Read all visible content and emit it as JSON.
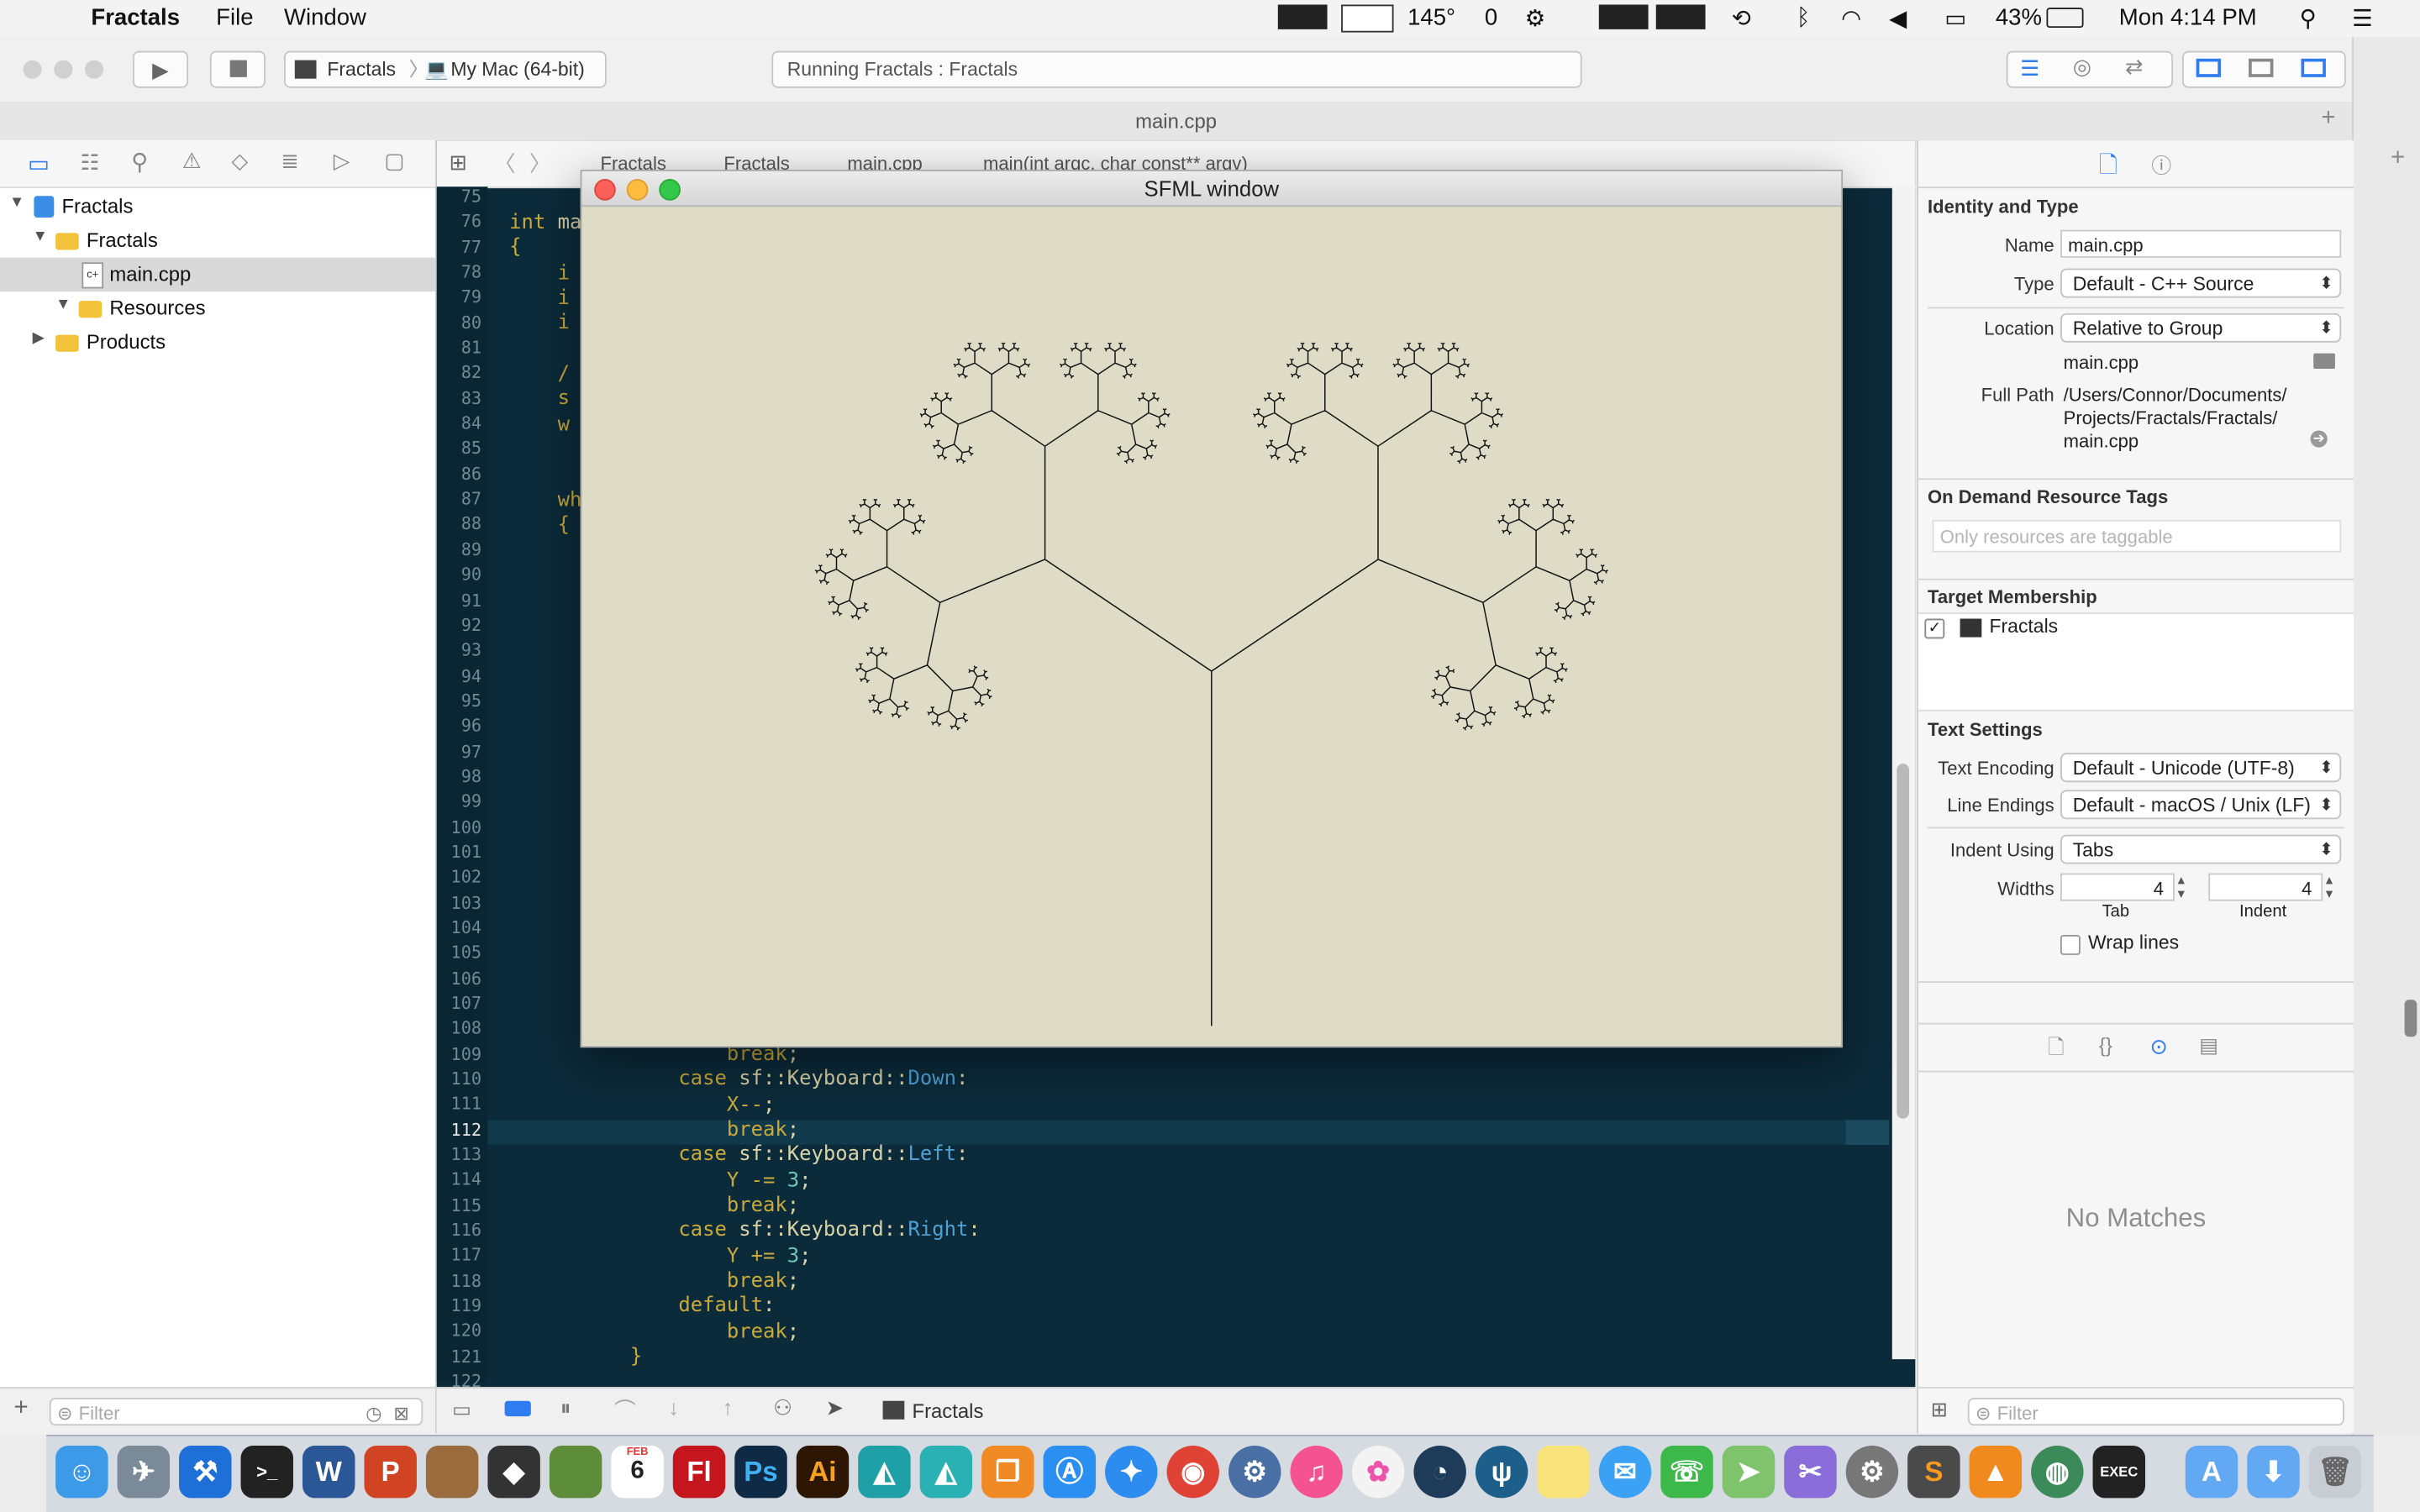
{
  "menubar": {
    "app": "Fractals",
    "menus": [
      "File",
      "Window"
    ],
    "status": {
      "temp": "145°",
      "count": "0",
      "battery": "43%",
      "clock": "Mon 4:14 PM"
    }
  },
  "toolbar": {
    "scheme": "Fractals",
    "destination": "My Mac (64-bit)",
    "activity": "Running Fractals : Fractals"
  },
  "tab": {
    "title": "main.cpp"
  },
  "jumpbar": {
    "items": [
      "Fractals",
      "Fractals",
      "main.cpp",
      "main(int argc, char const** argv)"
    ]
  },
  "navigator": {
    "items": [
      {
        "label": "Fractals"
      },
      {
        "label": "Fractals"
      },
      {
        "label": "main.cpp"
      },
      {
        "label": "Resources"
      },
      {
        "label": "Products"
      }
    ],
    "filter_placeholder": "Filter"
  },
  "editor": {
    "line_numbers": [
      "75",
      "76",
      "77",
      "78",
      "79",
      "80",
      "81",
      "82",
      "83",
      "84",
      "85",
      "86",
      "87",
      "88",
      "89",
      "90",
      "91",
      "92",
      "93",
      "94",
      "95",
      "96",
      "97",
      "98",
      "99",
      "100",
      "101",
      "102",
      "103",
      "104",
      "105",
      "106",
      "107",
      "108",
      "109",
      "110",
      "111",
      "112",
      "113",
      "114",
      "115",
      "116",
      "117",
      "118",
      "119",
      "120",
      "121",
      "122"
    ],
    "top_lines": [
      {
        "a": "int",
        "b": " ma"
      },
      {
        "a": "{",
        "b": ""
      },
      {
        "a": "    i",
        "b": ""
      },
      {
        "a": "    i",
        "b": ""
      },
      {
        "a": "    i",
        "b": ""
      },
      {
        "a": "",
        "b": ""
      },
      {
        "a": "    /",
        "b": ""
      },
      {
        "a": "    s",
        "b": ""
      },
      {
        "a": "    w",
        "b": ""
      },
      {
        "a": "",
        "b": ""
      },
      {
        "a": "",
        "b": ""
      },
      {
        "a": "    wh",
        "b": ""
      },
      {
        "a": "    {",
        "b": ""
      }
    ],
    "bottom_lines": [
      {
        "indent": "                  ",
        "kw": "break",
        "rest": ";",
        "ty": "",
        "tail": ""
      },
      {
        "indent": "              ",
        "kw": "case",
        "rest": " sf::Keyboard::",
        "ty": "Down",
        "tail": ":"
      },
      {
        "indent": "                  ",
        "kw": "X--",
        "rest": ";",
        "ty": "",
        "tail": ""
      },
      {
        "indent": "                  ",
        "kw": "break",
        "rest": ";",
        "ty": "",
        "tail": ""
      },
      {
        "indent": "              ",
        "kw": "case",
        "rest": " sf::Keyboard::",
        "ty": "Left",
        "tail": ":"
      },
      {
        "indent": "                  ",
        "kw": "Y -= ",
        "rest": "",
        "ty": "",
        "num": "3",
        "tail": ";"
      },
      {
        "indent": "                  ",
        "kw": "break",
        "rest": ";",
        "ty": "",
        "tail": ""
      },
      {
        "indent": "              ",
        "kw": "case",
        "rest": " sf::Keyboard::",
        "ty": "Right",
        "tail": ":"
      },
      {
        "indent": "                  ",
        "kw": "Y += ",
        "rest": "",
        "ty": "",
        "num": "3",
        "tail": ";"
      },
      {
        "indent": "                  ",
        "kw": "break",
        "rest": ";",
        "ty": "",
        "tail": ""
      },
      {
        "indent": "              ",
        "kw": "default",
        "rest": ":",
        "ty": "",
        "tail": ""
      },
      {
        "indent": "                  ",
        "kw": "break",
        "rest": ";",
        "ty": "",
        "tail": ""
      },
      {
        "indent": "          ",
        "kw": "}",
        "rest": "",
        "ty": "",
        "tail": ""
      }
    ]
  },
  "sfml": {
    "title": "SFML window"
  },
  "inspector": {
    "identity": {
      "title": "Identity and Type",
      "name_label": "Name",
      "name_value": "main.cpp",
      "type_label": "Type",
      "type_value": "Default - C++ Source",
      "location_label": "Location",
      "location_value": "Relative to Group",
      "location_file": "main.cpp",
      "fullpath_label": "Full Path",
      "fullpath_lines": [
        "/Users/Connor/Documents/",
        "Projects/Fractals/Fractals/",
        "main.cpp"
      ]
    },
    "ondemand": {
      "title": "On Demand Resource Tags",
      "placeholder": "Only resources are taggable"
    },
    "target": {
      "title": "Target Membership",
      "item": "Fractals"
    },
    "text": {
      "title": "Text Settings",
      "encoding_label": "Text Encoding",
      "encoding_value": "Default - Unicode (UTF-8)",
      "endings_label": "Line Endings",
      "endings_value": "Default - macOS / Unix (LF)",
      "indent_label": "Indent Using",
      "indent_value": "Tabs",
      "widths_label": "Widths",
      "tab_value": "4",
      "indent_width_value": "4",
      "tab_caption": "Tab",
      "indent_caption": "Indent",
      "wrap_label": "Wrap lines"
    },
    "library": {
      "no_matches": "No Matches",
      "filter_placeholder": "Filter"
    }
  },
  "debugbar": {
    "target": "Fractals"
  },
  "dock": {
    "labels": [
      "W",
      "P",
      "Fl",
      "Ps",
      "Ai",
      "S"
    ],
    "calendar_day": "6",
    "calendar_month": "FEB"
  }
}
